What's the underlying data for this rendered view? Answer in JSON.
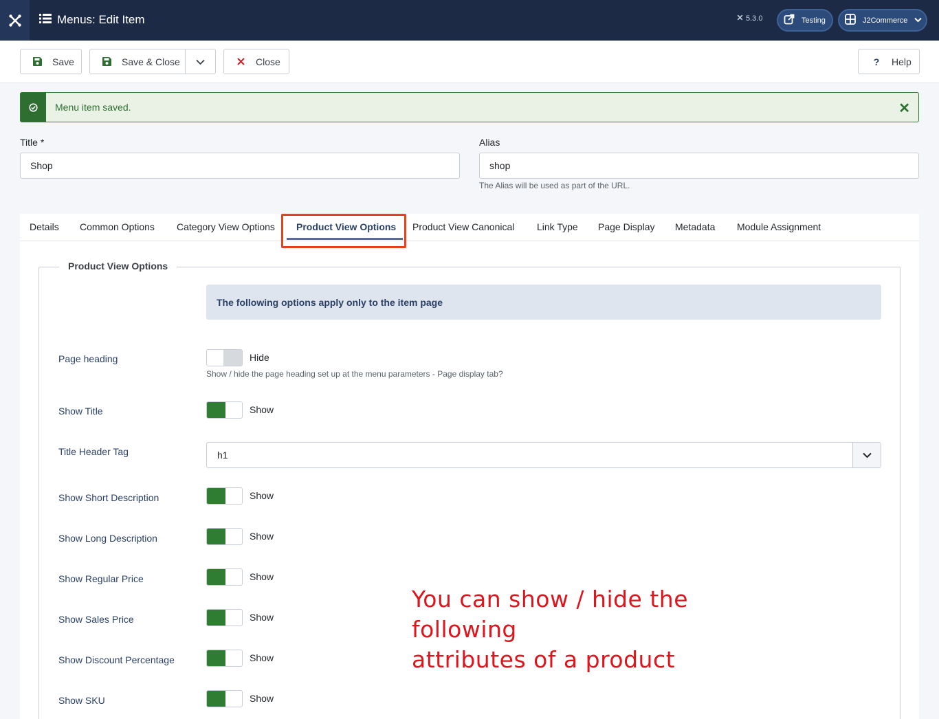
{
  "header": {
    "title": "Menus: Edit Item",
    "version": "5.3.0",
    "testing_label": "Testing",
    "user_menu_label": "J2Commerce"
  },
  "toolbar": {
    "save_label": "Save",
    "save_close_label": "Save & Close",
    "close_label": "Close",
    "help_label": "Help"
  },
  "alert": {
    "message": "Menu item saved."
  },
  "form": {
    "title_label": "Title *",
    "title_value": "Shop",
    "alias_label": "Alias",
    "alias_value": "shop",
    "alias_hint": "The Alias will be used as part of the URL."
  },
  "tabs": [
    {
      "label": "Details"
    },
    {
      "label": "Common Options"
    },
    {
      "label": "Category View Options"
    },
    {
      "label": "Product View Options"
    },
    {
      "label": "Product View Canonical"
    },
    {
      "label": "Link Type"
    },
    {
      "label": "Page Display"
    },
    {
      "label": "Metadata"
    },
    {
      "label": "Module Assignment"
    }
  ],
  "active_tab": "Product View Options",
  "panel": {
    "legend": "Product View Options",
    "info": "The following options apply only to the item page",
    "options": [
      {
        "label": "Page heading",
        "state": "Hide",
        "on": false,
        "hint": "Show / hide the page heading set up at the menu parameters - Page display tab?"
      },
      {
        "label": "Show Title",
        "state": "Show",
        "on": true
      },
      {
        "label": "Title Header Tag",
        "value": "h1"
      },
      {
        "label": "Show Short Description",
        "state": "Show",
        "on": true
      },
      {
        "label": "Show Long Description",
        "state": "Show",
        "on": true
      },
      {
        "label": "Show Regular Price",
        "state": "Show",
        "on": true
      },
      {
        "label": "Show Sales Price",
        "state": "Show",
        "on": true
      },
      {
        "label": "Show Discount Percentage",
        "state": "Show",
        "on": true
      },
      {
        "label": "Show SKU",
        "state": "Show",
        "on": true
      }
    ]
  },
  "annotation": {
    "line1": "You can show / hide the following",
    "line2": "attributes of a product"
  },
  "colors": {
    "header_bg": "#1c2a45",
    "toggle_on": "#2e7d32",
    "alert_green": "#2e6e31",
    "highlight_red": "#e8421c",
    "annotation_red": "#e0141c"
  }
}
